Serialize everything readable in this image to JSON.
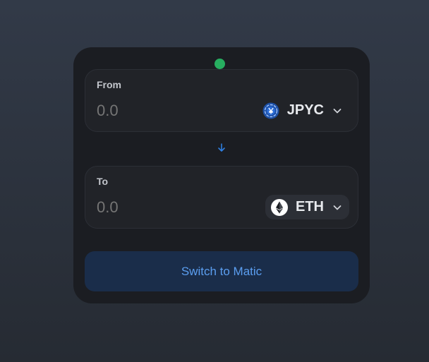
{
  "status": {
    "color": "#27ae60"
  },
  "swap": {
    "from": {
      "label": "From",
      "amount_placeholder": "0.0",
      "token": {
        "symbol": "JPYC",
        "icon": "jpyc-icon"
      }
    },
    "direction_icon": "arrow-down-icon",
    "to": {
      "label": "To",
      "amount_placeholder": "0.0",
      "token": {
        "symbol": "ETH",
        "icon": "eth-icon"
      }
    }
  },
  "action": {
    "label": "Switch to Matic"
  },
  "colors": {
    "card_background": "#1b1d22",
    "panel_background": "#212328",
    "button_background": "#1a2d4a",
    "button_text": "#5b9ef0",
    "accent_blue": "#2f7fe0"
  }
}
